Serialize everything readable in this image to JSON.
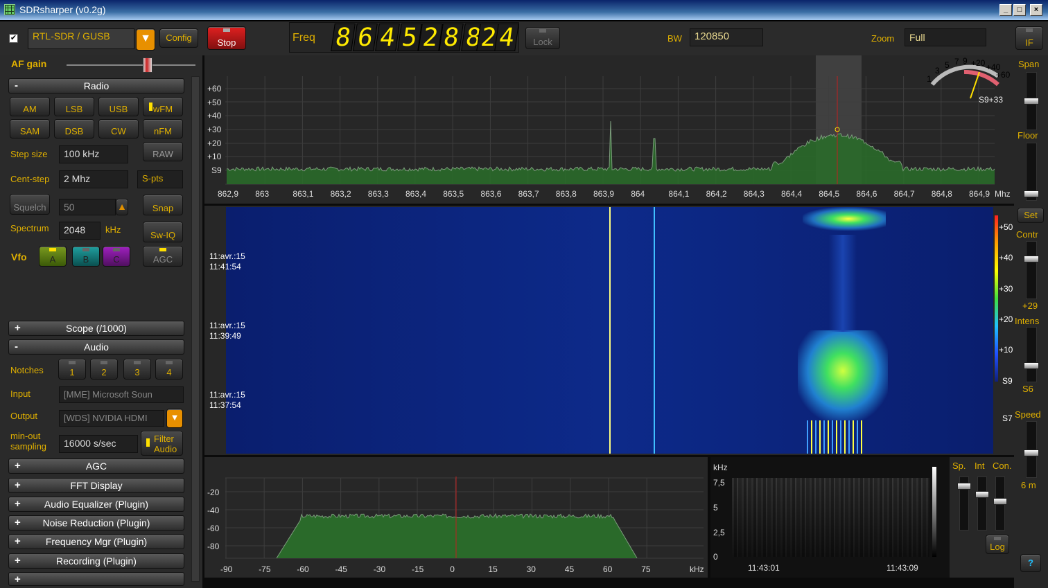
{
  "window": {
    "title": "SDRsharper (v0.2g)"
  },
  "top": {
    "device": "RTL-SDR / GUSB",
    "config": "Config",
    "stop": "Stop",
    "freq_label": "Freq",
    "freq_digits": [
      "8",
      "6",
      "4",
      "5",
      "2",
      "8",
      "8",
      "2",
      "4"
    ],
    "lock": "Lock",
    "bw_label": "BW",
    "bw_value": "120850",
    "zoom_label": "Zoom",
    "zoom_value": "Full",
    "if_btn": "IF"
  },
  "left": {
    "af_gain": "AF gain",
    "radio_section": "Radio",
    "modes": [
      "AM",
      "LSB",
      "USB",
      "wFM",
      "SAM",
      "DSB",
      "CW",
      "nFM"
    ],
    "active_mode": "wFM",
    "raw": "RAW",
    "step_label": "Step size",
    "step_value": "100 kHz",
    "cent_label": "Cent-step",
    "cent_value": "2 Mhz",
    "spts": "S-pts",
    "squelch": "Squelch",
    "squelch_value": "50",
    "snap": "Snap",
    "spectrum_label": "Spectrum",
    "spectrum_value": "2048",
    "spectrum_unit": "kHz",
    "swiq": "Sw-IQ",
    "vfo_label": "Vfo",
    "vfo": [
      "A",
      "B",
      "C"
    ],
    "agc_btn": "AGC",
    "scope_section": "Scope (/1000)",
    "audio_section": "Audio",
    "notches_label": "Notches",
    "notches": [
      "1",
      "2",
      "3",
      "4"
    ],
    "input_label": "Input",
    "input_value": "[MME] Microsoft Soun",
    "output_label": "Output",
    "output_value": "[WDS] NVIDIA HDMI",
    "minout_label1": "min-out",
    "minout_label2": "sampling",
    "sampling_value": "16000 s/sec",
    "filter_audio1": "Filter",
    "filter_audio2": "Audio",
    "sections": [
      "AGC",
      "FFT Display",
      "Audio Equalizer (Plugin)",
      "Noise Reduction (Plugin)",
      "Frequency Mgr (Plugin)",
      "Recording (Plugin)"
    ]
  },
  "spectrum": {
    "y_ticks": [
      "+60",
      "+50",
      "+40",
      "+30",
      "+20",
      "+10",
      "S9"
    ],
    "x_ticks": [
      "862,9",
      "863",
      "863,1",
      "863,2",
      "863,3",
      "863,4",
      "863,5",
      "863,6",
      "863,7",
      "863,8",
      "863,9",
      "864",
      "864,1",
      "864,2",
      "864,3",
      "864,4",
      "864,5",
      "864,6",
      "864,7",
      "864,8",
      "864,9"
    ],
    "x_unit": "Mhz",
    "smeter_ticks": [
      "1",
      "3",
      "5",
      "7",
      "9",
      "+20",
      "+40",
      "+60"
    ],
    "smeter_reading": "S9+33"
  },
  "waterfall": {
    "timestamps": [
      {
        "d": "11:avr.:15",
        "t": "11:41:54"
      },
      {
        "d": "11:avr.:15",
        "t": "11:39:49"
      },
      {
        "d": "11:avr.:15",
        "t": "11:37:54"
      }
    ],
    "scale": [
      "+50",
      "+40",
      "+30",
      "+20",
      "+10",
      "S9",
      "S7"
    ]
  },
  "right": {
    "span": "Span",
    "floor": "Floor",
    "set": "Set",
    "contr": "Contr",
    "contr_value": "+29",
    "intens": "Intens",
    "intens_value": "S6",
    "speed": "Speed",
    "speed_value": "6 m"
  },
  "audio_spectrum": {
    "y_ticks": [
      "-20",
      "-40",
      "-60",
      "-80"
    ],
    "x_ticks": [
      "-90",
      "-75",
      "-60",
      "-45",
      "-30",
      "-15",
      "0",
      "15",
      "30",
      "45",
      "60",
      "75"
    ],
    "x_unit": "kHz"
  },
  "audio_waterfall": {
    "unit": "kHz",
    "y_ticks": [
      "7,5",
      "5",
      "2,5",
      "0"
    ],
    "times": [
      "11:43:01",
      "11:43:09"
    ]
  },
  "bottom_right": {
    "sp": "Sp.",
    "int": "Int",
    "con": "Con.",
    "log": "Log",
    "help": "?"
  }
}
